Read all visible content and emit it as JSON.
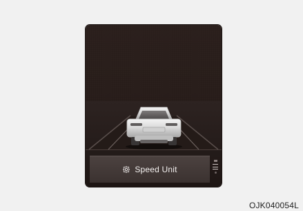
{
  "cluster": {
    "menu_item": {
      "label": "Speed Unit",
      "icon": "gear-icon"
    },
    "scroll_indicator": {
      "icon": "scroll-position-icon"
    },
    "scene": {
      "vehicle": "car-rear-icon"
    }
  },
  "figure_code": "OJK040054L",
  "colors": {
    "background": "#f1f1f1",
    "cluster_dark": "#281d1a",
    "menu_bar": "#4c4240",
    "menu_text": "#f4f1f0"
  }
}
